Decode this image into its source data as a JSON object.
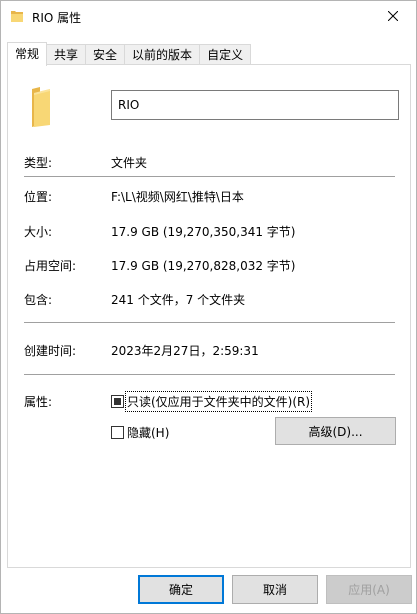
{
  "window": {
    "title": "RIO 属性",
    "close_glyph": "✕"
  },
  "tabs": [
    {
      "label": "常规",
      "active": true
    },
    {
      "label": "共享",
      "active": false
    },
    {
      "label": "安全",
      "active": false
    },
    {
      "label": "以前的版本",
      "active": false
    },
    {
      "label": "自定义",
      "active": false
    }
  ],
  "general": {
    "name_value": "RIO",
    "rows": {
      "type": {
        "label": "类型:",
        "value": "文件夹"
      },
      "location": {
        "label": "位置:",
        "value": "F:\\L\\视频\\网红\\推特\\日本"
      },
      "size": {
        "label": "大小:",
        "value": "17.9 GB (19,270,350,341 字节)"
      },
      "size_on_disk": {
        "label": "占用空间:",
        "value": "17.9 GB (19,270,828,032 字节)"
      },
      "contains": {
        "label": "包含:",
        "value": "241 个文件，7 个文件夹"
      },
      "created": {
        "label": "创建时间:",
        "value": "2023年2月27日，2:59:31"
      }
    },
    "attributes": {
      "label": "属性:",
      "readonly_label": "只读(仅应用于文件夹中的文件)(R)",
      "readonly_state": "indeterminate",
      "hidden_label": "隐藏(H)",
      "hidden_checked": false,
      "advanced_label": "高级(D)..."
    }
  },
  "buttons": {
    "ok": "确定",
    "cancel": "取消",
    "apply": "应用(A)"
  },
  "colors": {
    "folder_yellow": "#f8d775",
    "folder_dark": "#e8b64a",
    "focus_blue": "#0078d7"
  },
  "icons": {
    "title_folder": "folder-icon",
    "big_folder": "folder-icon",
    "close": "close-icon"
  }
}
